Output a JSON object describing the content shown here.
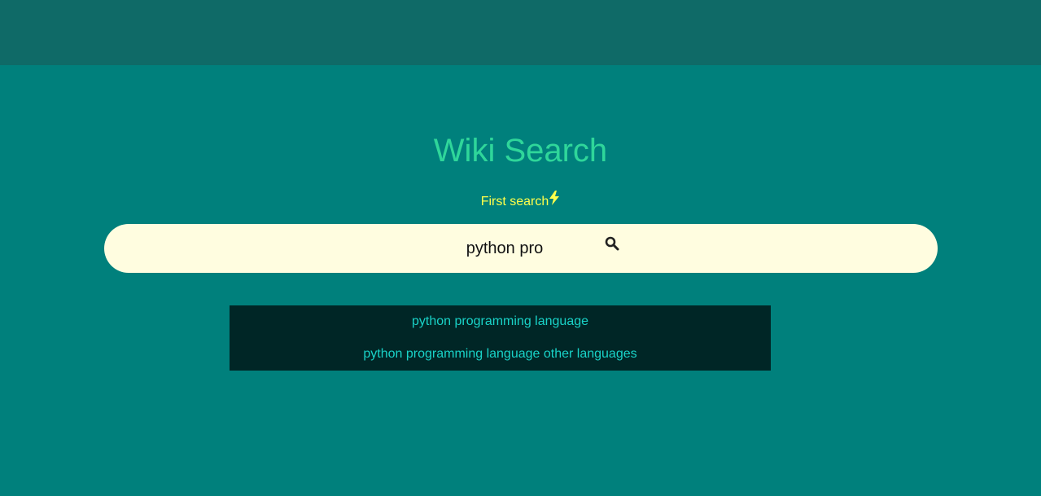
{
  "app": {
    "title": "Wiki Search",
    "subtitle": "First search"
  },
  "search": {
    "value": "python pro",
    "icon": "search-icon"
  },
  "suggestions": [
    "python programming language",
    "python programming language other languages"
  ],
  "colors": {
    "background": "#00807c",
    "topbar": "#0f6a67",
    "title": "#2fd69a",
    "subtitle": "#ffff4a",
    "searchbar": "#fffde0",
    "suggestions_bg": "#002626",
    "suggestion_text": "#19d3c8"
  }
}
